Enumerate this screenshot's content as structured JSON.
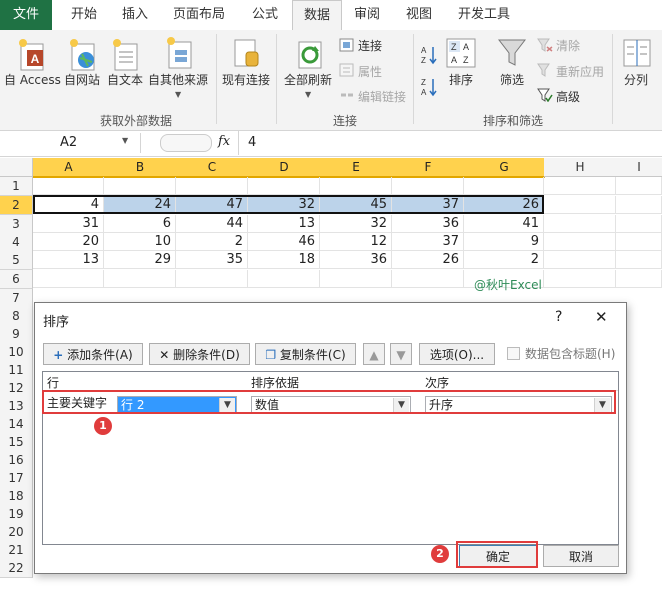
{
  "tabs": [
    "文件",
    "开始",
    "插入",
    "页面布局",
    "公式",
    "数据",
    "审阅",
    "视图",
    "开发工具"
  ],
  "ribbon": {
    "get_external": {
      "access": "自 Access",
      "web": "自网站",
      "text": "自文本",
      "other": "自其他来源",
      "existing": "现有连接",
      "group_label": "获取外部数据"
    },
    "connections": {
      "refresh_all": "全部刷新",
      "connections": "连接",
      "properties": "属性",
      "edit_links": "编辑链接",
      "group_label": "连接"
    },
    "sort_filter": {
      "sort": "排序",
      "filter": "筛选",
      "clear": "清除",
      "reapply": "重新应用",
      "advanced": "高级",
      "group_label": "排序和筛选"
    },
    "split": "分列"
  },
  "formula_bar": {
    "name_box": "A2",
    "fx": "fx",
    "value": "4"
  },
  "grid": {
    "columns": [
      "A",
      "B",
      "C",
      "D",
      "E",
      "F",
      "G",
      "H",
      "I"
    ],
    "rows": [
      "1",
      "2",
      "3",
      "4",
      "5",
      "6",
      "7",
      "8",
      "9",
      "10",
      "11",
      "12",
      "13",
      "14",
      "15",
      "16",
      "17",
      "18",
      "19",
      "20",
      "21",
      "22"
    ],
    "data": [
      [
        "4",
        "24",
        "47",
        "32",
        "45",
        "37",
        "26"
      ],
      [
        "31",
        "6",
        "44",
        "13",
        "32",
        "36",
        "41"
      ],
      [
        "20",
        "10",
        "2",
        "46",
        "12",
        "37",
        "9"
      ],
      [
        "13",
        "29",
        "35",
        "18",
        "36",
        "26",
        "2"
      ]
    ],
    "watermark": "@秋叶Excel"
  },
  "dialog": {
    "title": "排序",
    "help": "?",
    "close": "✕",
    "add_condition": "添加条件(A)",
    "delete_condition": "删除条件(D)",
    "copy_condition": "复制条件(C)",
    "options": "选项(O)...",
    "has_header": "数据包含标题(H)",
    "col_headers": [
      "行",
      "排序依据",
      "次序"
    ],
    "row_label": "主要关键字",
    "key_value": "行 2",
    "sort_on_value": "数值",
    "order_value": "升序",
    "ok": "确定",
    "cancel": "取消",
    "badge1": "1",
    "badge2": "2"
  }
}
